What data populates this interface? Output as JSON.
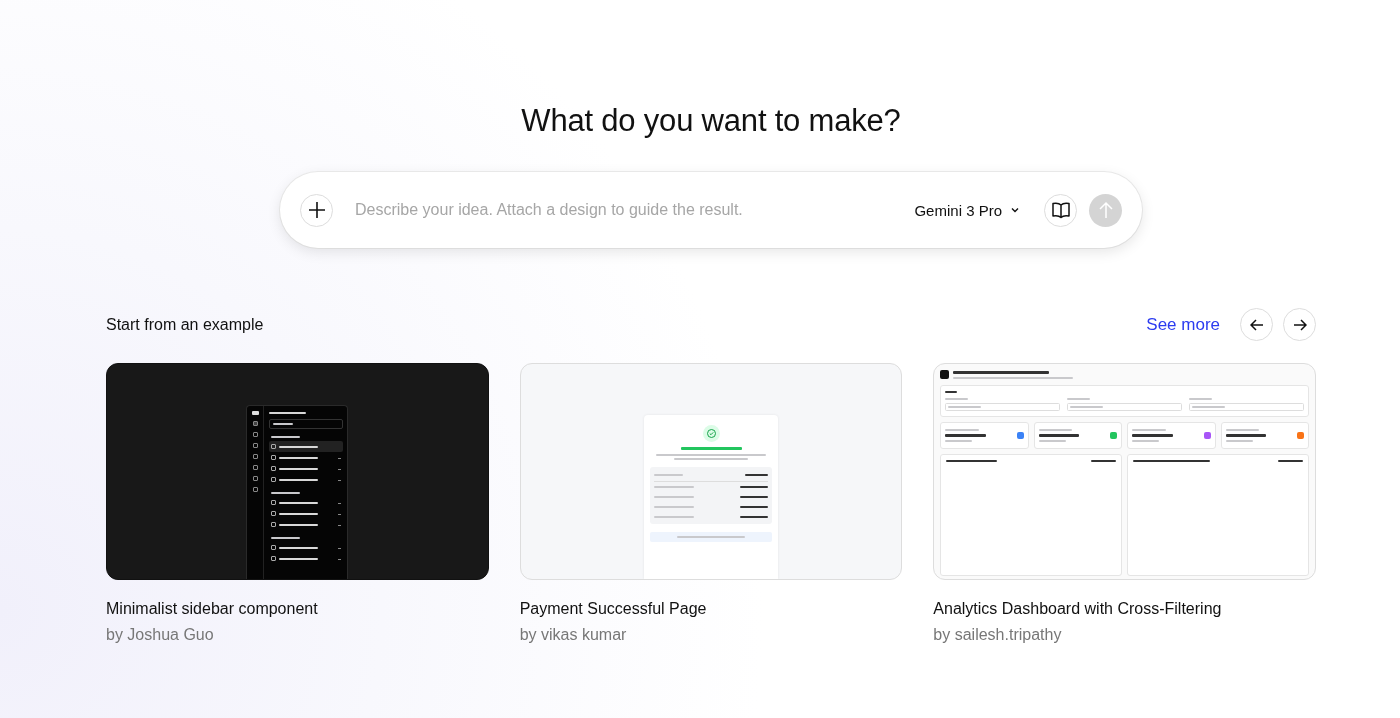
{
  "heading": "What do you want to make?",
  "prompt": {
    "placeholder": "Describe your idea. Attach a design to guide the result.",
    "model": "Gemini 3 Pro",
    "send_disabled": true
  },
  "examples_header": {
    "title": "Start from an example",
    "see_more": "See more"
  },
  "examples": [
    {
      "kind": "sidebar",
      "title": "Minimalist sidebar component",
      "author": "by Joshua Guo"
    },
    {
      "kind": "payment",
      "title": "Payment Successful Page",
      "author": "by vikas kumar"
    },
    {
      "kind": "analytics",
      "title": "Analytics Dashboard with Cross-Filtering",
      "author": "by sailesh.tripathy"
    }
  ]
}
